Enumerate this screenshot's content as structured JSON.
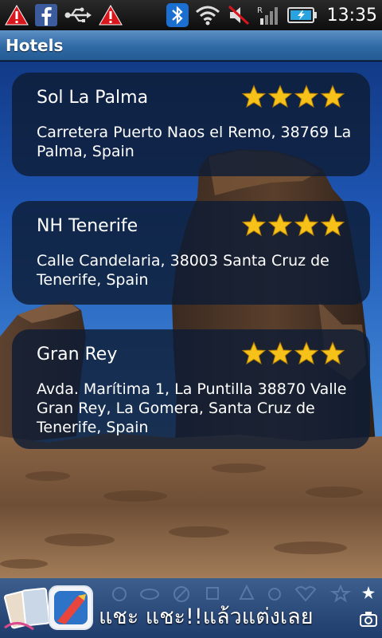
{
  "status_bar": {
    "time": "13:35",
    "left_icons": [
      "warning-icon",
      "facebook-icon",
      "usb-icon",
      "warning-icon"
    ],
    "right_icons": [
      "bluetooth-icon",
      "wifi-icon",
      "muted-speaker-icon",
      "signal-icon",
      "battery-charging-icon"
    ]
  },
  "header": {
    "title": "Hotels"
  },
  "hotels": [
    {
      "name": "Sol La Palma",
      "address": "Carretera Puerto Naos el Remo, 38769 La Palma, Spain",
      "rating": 4
    },
    {
      "name": "NH Tenerife",
      "address": "Calle Candelaria, 38003 Santa Cruz de Tenerife, Spain",
      "rating": 4
    },
    {
      "name": "Gran Rey",
      "address": "Avda. Marítima 1, La Puntilla 38870 Valle Gran Rey, La Gomera, Santa Cruz de Tenerife, Spain",
      "rating": 4
    }
  ],
  "ad": {
    "text": "แชะ แชะ!!แล้วแต่งเลย",
    "icon": "photo-editor-app-icon"
  },
  "colors": {
    "title_bar": "#2f6aa6",
    "card_bg": "#0e1c34",
    "star": "#f6c21a"
  }
}
